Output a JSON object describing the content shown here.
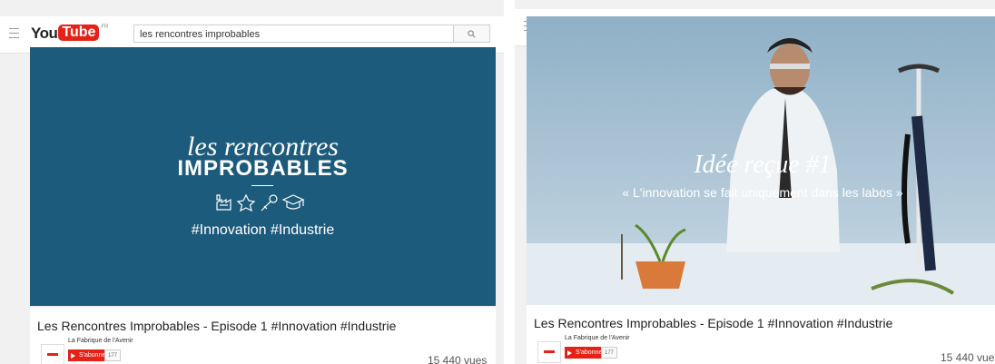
{
  "brand": {
    "you": "You",
    "tube": "Tube",
    "tm": "FR"
  },
  "search": {
    "query": "les rencontres improbables"
  },
  "left": {
    "title_line1": "les rencontres",
    "title_line2": "IMPROBABLES",
    "tags": "#Innovation  #Industrie",
    "icon_names": [
      "factory-icon",
      "star-icon",
      "microphone-icon",
      "graduation-cap-icon"
    ]
  },
  "right": {
    "myth_title": "Idée reçue #1",
    "myth_subtitle": "« L'innovation se fait uniquement dans les labos »"
  },
  "video": {
    "title": "Les Rencontres Improbables - Episode 1 #Innovation #Industrie",
    "channel": "La Fabrique de l'Avenir",
    "subscribe_label": "S'abonner",
    "subscriber_count": "177",
    "views": "15 440 vues"
  },
  "colors": {
    "brand_red": "#e62117",
    "left_bg": "#1d5b7c",
    "right_bg": "#aac3d6"
  }
}
